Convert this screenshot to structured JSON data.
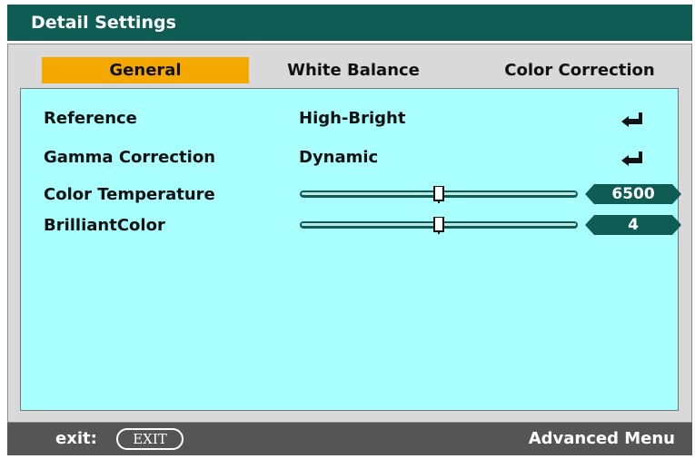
{
  "title": "Detail Settings",
  "tabs": [
    {
      "label": "General",
      "active": true
    },
    {
      "label": "White Balance",
      "active": false
    },
    {
      "label": "Color Correction",
      "active": false
    }
  ],
  "settings": [
    {
      "label": "Reference",
      "value": "High-Bright",
      "icon": "enter-arrow-icon"
    },
    {
      "label": "Gamma Correction",
      "value": "Dynamic",
      "icon": "enter-arrow-icon"
    },
    {
      "label": "Color Temperature",
      "slider_fraction": 0.5,
      "value": "6500"
    },
    {
      "label": "BrilliantColor",
      "slider_fraction": 0.5,
      "value": "4"
    }
  ],
  "footer": {
    "exit_label": "exit:",
    "exit_button": "EXIT",
    "right_text": "Advanced Menu"
  },
  "colors": {
    "title_bar": "#0e5c53",
    "active_tab": "#f5a800",
    "content_bg": "#aaffff",
    "panel_bg": "#d9d9d9",
    "footer_bg": "#555555",
    "badge": "#0e5c53"
  }
}
